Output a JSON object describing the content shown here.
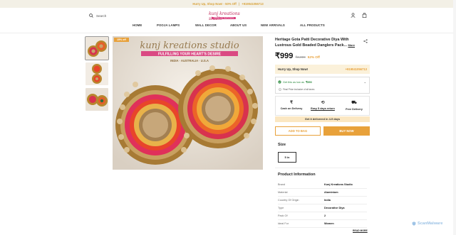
{
  "announcement": {
    "text": "Hurry Up, Shop Now! - 50% Off",
    "sep": "|",
    "phone": "+919041056713"
  },
  "header": {
    "search_label": "Search",
    "logo_text": "kunj kreations studio",
    "logo_tagline": "fulfilling your heart's desire",
    "icons": [
      "search-icon",
      "user-icon",
      "bag-icon"
    ]
  },
  "nav": {
    "items": [
      "HOME",
      "POOJA LAMPS",
      "WALL DECOR",
      "ABOUT US",
      "NEW ARRIVALS",
      "ALL PRODUCTS"
    ]
  },
  "gallery": {
    "badge": "15% off"
  },
  "product": {
    "title": "Heritage Gota Patti Decorative Diya With Lustrous Gold Beaded Danglers Pack...",
    "more_label": "More",
    "price": "₹999",
    "mrp": "₹2,099",
    "discount": "52% Off",
    "hurry_text": "Hurry Up, Shop Now!",
    "hurry_phone": "+919041056713",
    "offer_text": "Get this as low as",
    "offer_price": "₹850",
    "offer_note": "Final Price inclusive of all taxes",
    "features": [
      {
        "icon": "rupee-icon",
        "label": "Cash on Delivery"
      },
      {
        "icon": "return-icon",
        "label": "Easy 5 days return"
      },
      {
        "icon": "truck-icon",
        "label": "Free Delivery"
      }
    ],
    "delivery_text": "Get it delivered in 4-9 days",
    "add_to_bag": "ADD TO BAG",
    "buy_now": "BUY NOW",
    "size_heading": "Size",
    "size_option": "5 in",
    "info_heading": "Product Information",
    "info": [
      {
        "k": "Brand",
        "v": "Kunj Kreations Studio"
      },
      {
        "k": "Material",
        "v": "Aluminium"
      },
      {
        "k": "Country Of Origin",
        "v": "India"
      },
      {
        "k": "Type",
        "v": "Decorative Diya"
      },
      {
        "k": "Pack Of",
        "v": "2"
      },
      {
        "k": "Ideal For",
        "v": "Women"
      }
    ],
    "read_more": "READ MORE"
  },
  "watermark": "ScanMalware",
  "colors": {
    "accent": "#e8a13a",
    "pink": "#d83a7a",
    "green": "#2b8a3e"
  }
}
